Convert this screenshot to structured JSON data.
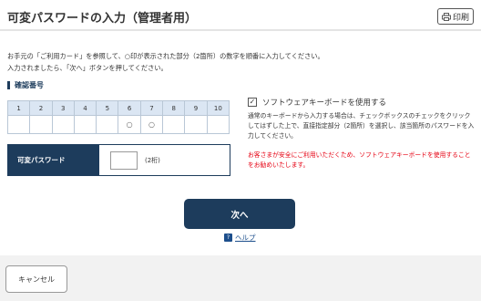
{
  "header": {
    "title": "可変パスワードの入力（管理者用）",
    "print_label": "印刷"
  },
  "instructions": {
    "line1": "お手元の「ご利用カード」を参照して、○印が表示された部分（2箇所）の数字を順番に入力してください。",
    "line2": "入力されましたら、「次へ」ボタンを押してください。"
  },
  "confirmation": {
    "label": "確認番号",
    "columns": [
      "1",
      "2",
      "3",
      "4",
      "5",
      "6",
      "7",
      "8",
      "9",
      "10"
    ],
    "marks": [
      "",
      "",
      "",
      "",
      "",
      "○",
      "○",
      "",
      "",
      ""
    ]
  },
  "password": {
    "label": "可変パスワード",
    "value": "",
    "digits_note": "(2桁)"
  },
  "software_keyboard": {
    "checked": true,
    "check_mark": "✓",
    "label": "ソフトウェアキーボードを使用する",
    "description": "通常のキーボードから入力する場合は、チェックボックスのチェックをクリックしてはずした上で、直接指定部分（2箇所）を選択し、該当箇所のパスワードを入力してください。",
    "warning": "お客さまが安全にご利用いただくため、ソフトウェアキーボードを使用することをお勧めいたします。"
  },
  "actions": {
    "next_label": "次へ",
    "help_label": "ヘルプ",
    "cancel_label": "キャンセル"
  },
  "colors": {
    "primary": "#1d3c5c",
    "warning": "#e60012",
    "grid_header": "#dbe6f3",
    "link": "#1d4f8c"
  }
}
